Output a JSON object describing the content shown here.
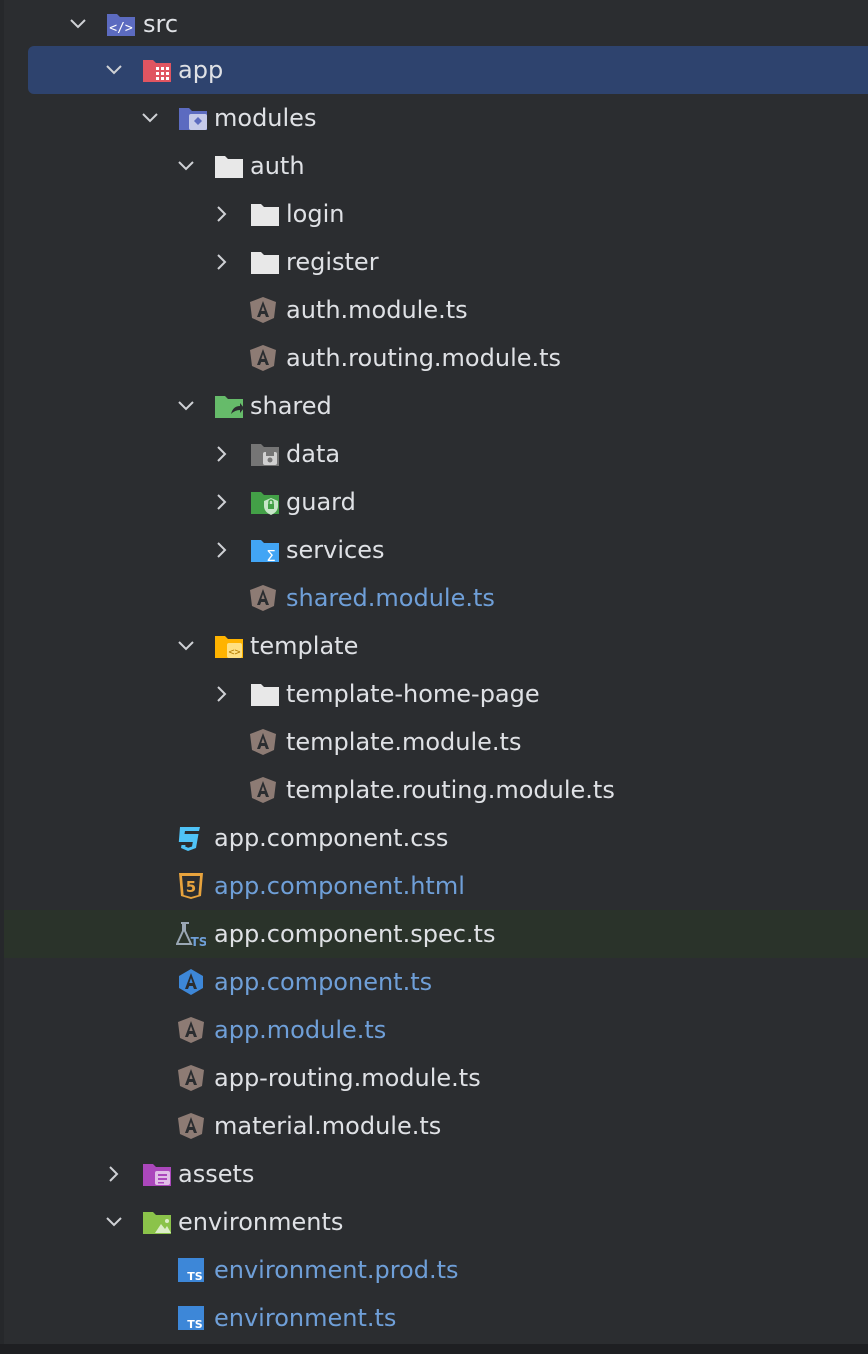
{
  "tree": {
    "items": [
      {
        "label": "src",
        "icon": "source-folder-icon",
        "expanded": true
      },
      {
        "label": "app",
        "icon": "app-module-folder-icon",
        "expanded": true,
        "selected": true
      },
      {
        "label": "modules",
        "icon": "modules-folder-icon",
        "expanded": true
      },
      {
        "label": "auth",
        "icon": "folder-icon",
        "expanded": true
      },
      {
        "label": "login",
        "icon": "folder-icon",
        "expanded": false
      },
      {
        "label": "register",
        "icon": "folder-icon",
        "expanded": false
      },
      {
        "label": "auth.module.ts",
        "icon": "angular-file-icon"
      },
      {
        "label": "auth.routing.module.ts",
        "icon": "angular-file-icon"
      },
      {
        "label": "shared",
        "icon": "shared-folder-icon",
        "expanded": true
      },
      {
        "label": "data",
        "icon": "data-folder-icon",
        "expanded": false
      },
      {
        "label": "guard",
        "icon": "guard-folder-icon",
        "expanded": false
      },
      {
        "label": "services",
        "icon": "services-folder-icon",
        "expanded": false
      },
      {
        "label": "shared.module.ts",
        "icon": "angular-file-icon",
        "modified": true
      },
      {
        "label": "template",
        "icon": "template-folder-icon",
        "expanded": true
      },
      {
        "label": "template-home-page",
        "icon": "folder-icon",
        "expanded": false
      },
      {
        "label": "template.module.ts",
        "icon": "angular-file-icon"
      },
      {
        "label": "template.routing.module.ts",
        "icon": "angular-file-icon"
      },
      {
        "label": "app.component.css",
        "icon": "css-file-icon"
      },
      {
        "label": "app.component.html",
        "icon": "html-file-icon",
        "modified": true
      },
      {
        "label": "app.component.spec.ts",
        "icon": "test-file-icon",
        "highlighted": true
      },
      {
        "label": "app.component.ts",
        "icon": "angular-component-icon",
        "modified": true
      },
      {
        "label": "app.module.ts",
        "icon": "angular-file-icon",
        "modified": true
      },
      {
        "label": "app-routing.module.ts",
        "icon": "angular-file-icon"
      },
      {
        "label": "material.module.ts",
        "icon": "angular-file-icon"
      },
      {
        "label": "assets",
        "icon": "assets-folder-icon",
        "expanded": false
      },
      {
        "label": "environments",
        "icon": "environments-folder-icon",
        "expanded": true
      },
      {
        "label": "environment.prod.ts",
        "icon": "typescript-file-icon",
        "modified": true
      },
      {
        "label": "environment.ts",
        "icon": "typescript-file-icon",
        "modified": true
      }
    ]
  },
  "colors": {
    "background": "#2b2d30",
    "selection": "#2e436e",
    "text": "#dfe1e5",
    "modified_text": "#6f9fd8"
  }
}
